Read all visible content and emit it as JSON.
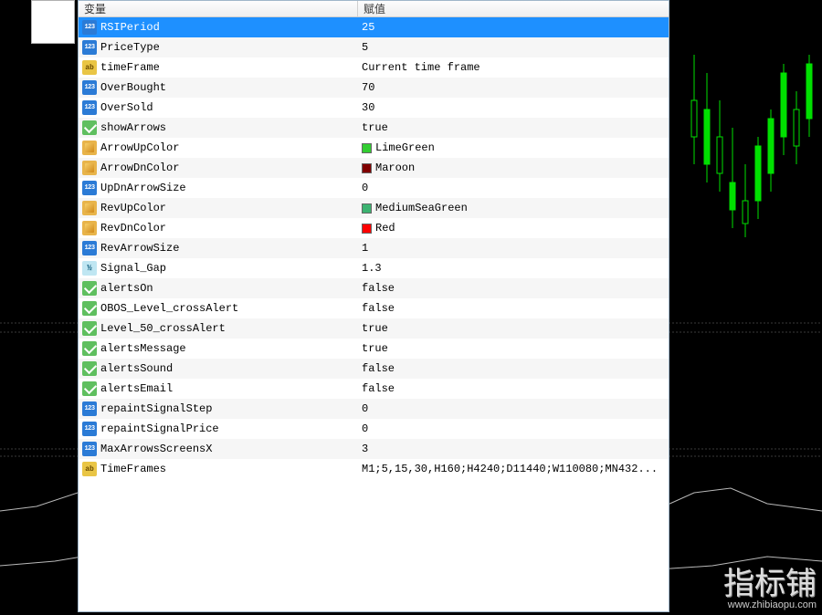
{
  "headers": {
    "variable": "变量",
    "value": "赋值"
  },
  "params": [
    {
      "icon": "int",
      "name": "RSIPeriod",
      "value": "25",
      "selected": true
    },
    {
      "icon": "int",
      "name": "PriceType",
      "value": "5"
    },
    {
      "icon": "str",
      "name": "timeFrame",
      "value": "Current time frame"
    },
    {
      "icon": "int",
      "name": "OverBought",
      "value": "70"
    },
    {
      "icon": "int",
      "name": "OverSold",
      "value": "30"
    },
    {
      "icon": "bool",
      "name": "showArrows",
      "value": "true"
    },
    {
      "icon": "color",
      "name": "ArrowUpColor",
      "value": "LimeGreen",
      "swatch": "#32cd32"
    },
    {
      "icon": "color",
      "name": "ArrowDnColor",
      "value": "Maroon",
      "swatch": "#800000"
    },
    {
      "icon": "int",
      "name": "UpDnArrowSize",
      "value": "0"
    },
    {
      "icon": "color",
      "name": "RevUpColor",
      "value": "MediumSeaGreen",
      "swatch": "#3cb371"
    },
    {
      "icon": "color",
      "name": "RevDnColor",
      "value": "Red",
      "swatch": "#ff0000"
    },
    {
      "icon": "int",
      "name": "RevArrowSize",
      "value": "1"
    },
    {
      "icon": "dbl",
      "name": "Signal_Gap",
      "value": "1.3"
    },
    {
      "icon": "bool",
      "name": "alertsOn",
      "value": "false"
    },
    {
      "icon": "bool",
      "name": "OBOS_Level_crossAlert",
      "value": "false"
    },
    {
      "icon": "bool",
      "name": "Level_50_crossAlert",
      "value": "true"
    },
    {
      "icon": "bool",
      "name": "alertsMessage",
      "value": "true"
    },
    {
      "icon": "bool",
      "name": "alertsSound",
      "value": "false"
    },
    {
      "icon": "bool",
      "name": "alertsEmail",
      "value": "false"
    },
    {
      "icon": "int",
      "name": "repaintSignalStep",
      "value": "0"
    },
    {
      "icon": "int",
      "name": "repaintSignalPrice",
      "value": "0"
    },
    {
      "icon": "int",
      "name": "MaxArrowsScreensX",
      "value": "3"
    },
    {
      "icon": "str",
      "name": "TimeFrames",
      "value": "M1;5,15,30,H160;H4240;D11440;W110080;MN432..."
    }
  ],
  "watermark": {
    "label": "指标铺",
    "url": "www.zhibiaopu.com"
  }
}
